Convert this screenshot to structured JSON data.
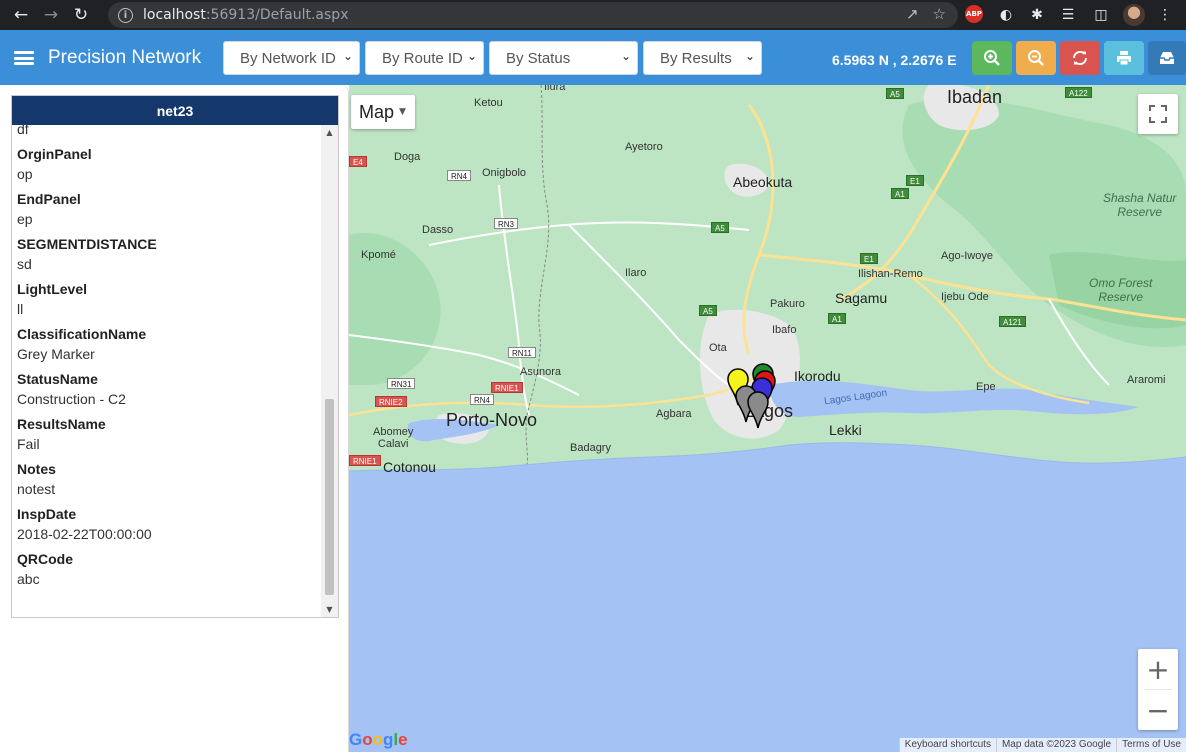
{
  "browser": {
    "url_host": "localhost",
    "url_port": ":56913",
    "url_path": "/Default.aspx",
    "abp_label": "ABP"
  },
  "header": {
    "title": "Precision Network",
    "filters": [
      "By Network ID",
      "By Route ID",
      "By Status",
      "By Results"
    ],
    "coords": "6.5963 N , 2.2676 E",
    "buttons": [
      {
        "name": "zoom-in",
        "color": "#5cb85c"
      },
      {
        "name": "zoom-out",
        "color": "#f0ad4e"
      },
      {
        "name": "refresh",
        "color": "#d9534f"
      },
      {
        "name": "print",
        "color": "#5bc0de"
      },
      {
        "name": "save",
        "color": "#337ab7"
      }
    ]
  },
  "panel": {
    "title": "net23",
    "partial_value": "df",
    "fields": [
      {
        "label": "OrginPanel",
        "value": "op"
      },
      {
        "label": "EndPanel",
        "value": "ep"
      },
      {
        "label": "SEGMENTDISTANCE",
        "value": "sd"
      },
      {
        "label": "LightLevel",
        "value": "ll"
      },
      {
        "label": "ClassificationName",
        "value": "Grey Marker"
      },
      {
        "label": "StatusName",
        "value": "Construction - C2"
      },
      {
        "label": "ResultsName",
        "value": "Fail"
      },
      {
        "label": "Notes",
        "value": "notest"
      },
      {
        "label": "InspDate",
        "value": "2018-02-22T00:00:00"
      },
      {
        "label": "QRCode",
        "value": "abc"
      }
    ]
  },
  "map": {
    "type_label": "Map",
    "places": {
      "ibadan": "Ibadan",
      "abeokuta": "Abeokuta",
      "ayetoro": "Ayetoro",
      "ketou": "Ketou",
      "doga": "Doga",
      "onigbolo": "Onigbolo",
      "dasso": "Dasso",
      "kpome": "Kpomé",
      "ilaro": "Ilaro",
      "pakuro": "Pakuro",
      "sagamu": "Sagamu",
      "ilishan": "Ilishan-Remo",
      "agoiwoye": "Ago-Iwoye",
      "ijebuode": "Ijebu Ode",
      "ibafo": "Ibafo",
      "ota": "Ota",
      "ikorodu": "Ikorodu",
      "epe": "Epe",
      "araromi": "Araromi",
      "asunora": "Asunora",
      "portonovo": "Porto-Novo",
      "agbara": "Agbara",
      "lagos": "Lagos",
      "lekki": "Lekki",
      "abomey": "Abomey\nCalavi",
      "cotonou": "Cotonou",
      "badagry": "Badagry",
      "ilura": "Ilura"
    },
    "parks": {
      "shasha": "Shasha Natur\nReserve",
      "omo": "Omo Forest\nReserve"
    },
    "water": {
      "lagoon": "Lagos Lagoon"
    },
    "shields": {
      "a5a": "A5",
      "a122": "A122",
      "e1a": "E1",
      "a1a": "A1",
      "a5b": "A5",
      "e1b": "E1",
      "a1b": "A1",
      "a5c": "A5",
      "a121": "A121",
      "rn4a": "RN4",
      "rn3": "RN3",
      "rn11": "RN11",
      "rn31": "RN31",
      "rnie1a": "RNIE1",
      "rn4b": "RN4",
      "rnie2": "RNIE2",
      "rnie1b": "RNIE1",
      "e4": "E4"
    },
    "markers": [
      "yellow",
      "green",
      "red",
      "blue",
      "grey",
      "grey"
    ],
    "google": "Google",
    "attribution": [
      "Keyboard shortcuts",
      "Map data ©2023 Google",
      "Terms of Use"
    ]
  }
}
